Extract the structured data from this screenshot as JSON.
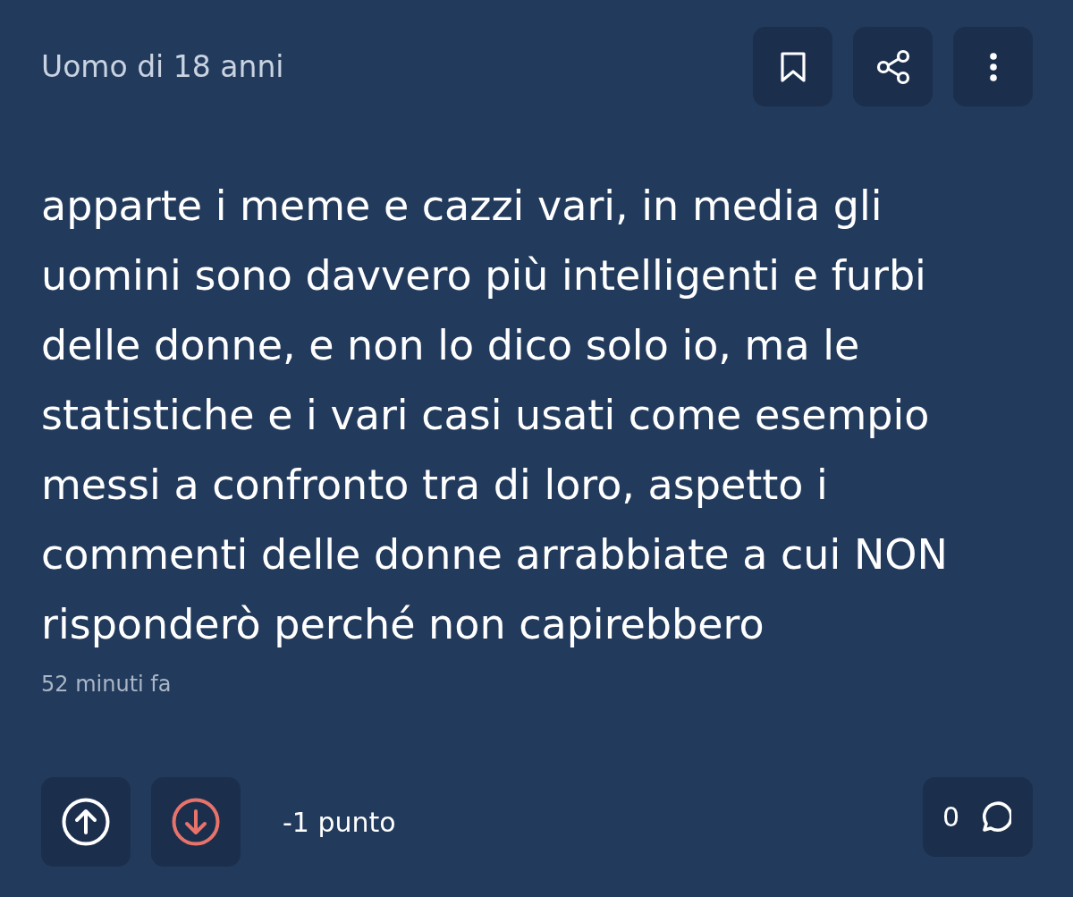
{
  "post": {
    "author": "Uomo di 18 anni",
    "actions": [
      {
        "kind": "bookmark"
      },
      {
        "kind": "share"
      },
      {
        "kind": "more"
      }
    ],
    "body": "apparte i meme e cazzi vari, in media gli uomini sono davvero più intelligenti e furbi delle donne, e non lo dico solo io, ma le statistiche e i vari casi usati come esempio messi a confronto tra di loro, aspetto i commenti delle donne arrabbiate a cui NON risponderò perché non capirebbero",
    "time": "52 minuti fa"
  },
  "footer": {
    "upvote": {
      "selected": false
    },
    "downvote": {
      "selected": true
    },
    "score": "-1 punto",
    "comments": {
      "count": "0"
    }
  }
}
